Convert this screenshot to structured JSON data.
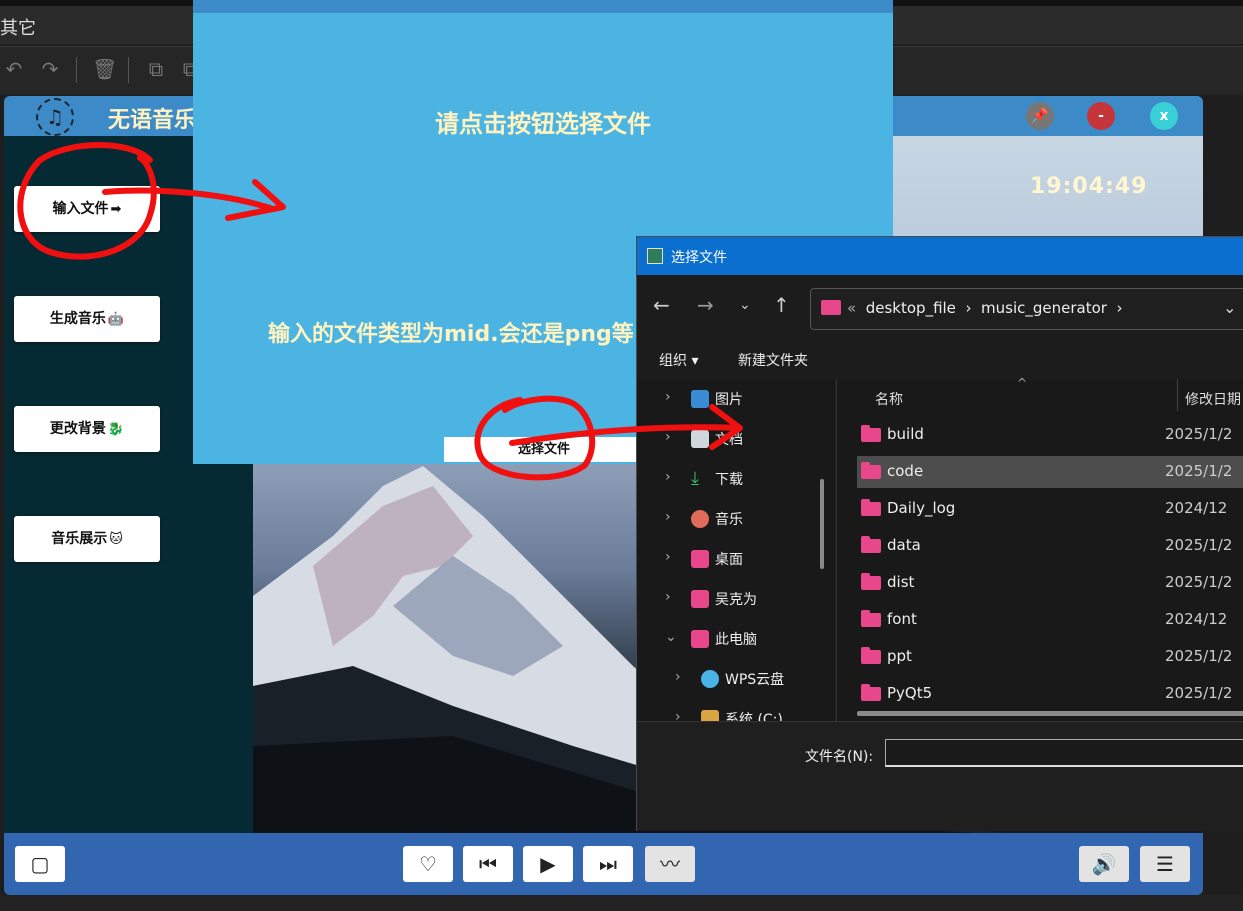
{
  "editor": {
    "menu_label": "其它",
    "toolbar_icons": [
      "undo-icon",
      "redo-icon",
      "delete-icon",
      "copy-icon",
      "paste-icon"
    ]
  },
  "app": {
    "title": "无语音乐",
    "clock": "19:04:49",
    "window_buttons": {
      "pin": "📌",
      "min": "-",
      "close": "x"
    },
    "sidebar": [
      {
        "label": "输入文件",
        "emoji": "➡"
      },
      {
        "label": "生成音乐",
        "emoji": "🤖"
      },
      {
        "label": "更改背景",
        "emoji": "🐉"
      },
      {
        "label": "音乐展示",
        "emoji": "🐱"
      }
    ],
    "controls": {
      "like": "♡",
      "prev": "⏮",
      "play": "▶",
      "next": "⏭",
      "wave": "〰",
      "volume": "🔊",
      "playlist": "☰"
    },
    "colors": {
      "titlebar": "#3d8ac9",
      "sidebar": "#062a33",
      "bottombar": "#3366b0"
    }
  },
  "select_dialog": {
    "heading": "请点击按钮选择文件",
    "info": "输入的文件类型为mid.会还是png等",
    "button": "选择文件",
    "color": "#4cb4e3"
  },
  "picker": {
    "title": "选择文件",
    "address": {
      "prefix": "«",
      "path": [
        "desktop_file",
        "music_generator"
      ],
      "sep": "›"
    },
    "commands": {
      "organize": "组织 ▾",
      "new_folder": "新建文件夹"
    },
    "tree": [
      {
        "label": "图片",
        "icon": "pictures-icon",
        "expanded": false
      },
      {
        "label": "文档",
        "icon": "documents-icon",
        "expanded": false
      },
      {
        "label": "下载",
        "icon": "downloads-icon",
        "expanded": false
      },
      {
        "label": "音乐",
        "icon": "music-icon",
        "expanded": false
      },
      {
        "label": "桌面",
        "icon": "desktop-icon",
        "expanded": false
      },
      {
        "label": "吴克为",
        "icon": "user-folder-icon",
        "expanded": false
      },
      {
        "label": "此电脑",
        "icon": "this-pc-icon",
        "expanded": true
      },
      {
        "label": "WPS云盘",
        "icon": "cloud-icon",
        "expanded": false
      },
      {
        "label": "系统 (C:)",
        "icon": "drive-icon",
        "expanded": false
      }
    ],
    "columns": {
      "name": "名称",
      "date": "修改日期"
    },
    "files": [
      {
        "name": "build",
        "date": "2025/1/2",
        "selected": false
      },
      {
        "name": "code",
        "date": "2025/1/2",
        "selected": true
      },
      {
        "name": "Daily_log",
        "date": "2024/12",
        "selected": false
      },
      {
        "name": "data",
        "date": "2025/1/2",
        "selected": false
      },
      {
        "name": "dist",
        "date": "2025/1/2",
        "selected": false
      },
      {
        "name": "font",
        "date": "2024/12",
        "selected": false
      },
      {
        "name": "ppt",
        "date": "2025/1/2",
        "selected": false
      },
      {
        "name": "PyQt5",
        "date": "2025/1/2",
        "selected": false
      }
    ],
    "filename_label": "文件名(N):",
    "filename_value": ""
  }
}
